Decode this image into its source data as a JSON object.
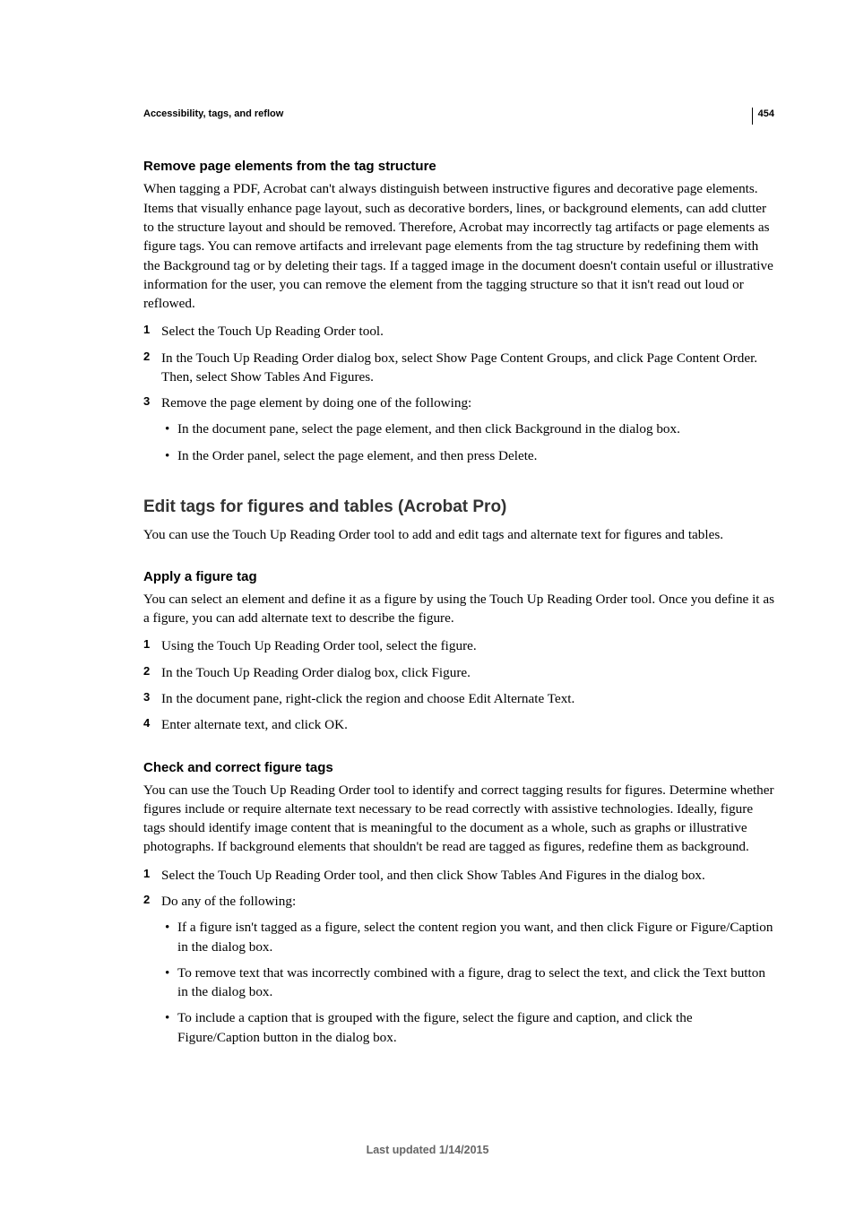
{
  "pageNumber": "454",
  "sectionHeader": "Accessibility, tags, and reflow",
  "s1": {
    "title": "Remove page elements from the tag structure",
    "intro": "When tagging a PDF, Acrobat can't always distinguish between instructive figures and decorative page elements. Items that visually enhance page layout, such as decorative borders, lines, or background elements, can add clutter to the structure layout and should be removed. Therefore, Acrobat may incorrectly tag artifacts or page elements as figure tags. You can remove artifacts and irrelevant page elements from the tag structure by redefining them with the Background tag or by deleting their tags. If a tagged image in the document doesn't contain useful or illustrative information for the user, you can remove the element from the tagging structure so that it isn't read out loud or reflowed.",
    "steps": [
      "Select the Touch Up Reading Order tool.",
      "In the Touch Up Reading Order dialog box, select Show Page Content Groups, and click Page Content Order. Then, select Show Tables And Figures.",
      "Remove the page element by doing one of the following:"
    ],
    "sub": [
      "In the document pane, select the page element, and then click Background in the dialog box.",
      "In the Order panel, select the page element, and then press Delete."
    ]
  },
  "h2": {
    "title": "Edit tags for figures and tables (Acrobat Pro)",
    "intro": "You can use the Touch Up Reading Order tool to add and edit tags and alternate text for figures and tables."
  },
  "s2": {
    "title": "Apply a figure tag",
    "intro": "You can select an element and define it as a figure by using the Touch Up Reading Order tool. Once you define it as a figure, you can add alternate text to describe the figure.",
    "steps": [
      "Using the Touch Up Reading Order tool, select the figure.",
      "In the Touch Up Reading Order dialog box, click Figure.",
      "In the document pane, right-click the region and choose Edit Alternate Text.",
      "Enter alternate text, and click OK."
    ]
  },
  "s3": {
    "title": "Check and correct figure tags",
    "intro": "You can use the Touch Up Reading Order tool to identify and correct tagging results for figures. Determine whether figures include or require alternate text necessary to be read correctly with assistive technologies. Ideally, figure tags should identify image content that is meaningful to the document as a whole, such as graphs or illustrative photographs. If background elements that shouldn't be read are tagged as figures, redefine them as background.",
    "steps": [
      "Select the Touch Up Reading Order tool, and then click Show Tables And Figures in the dialog box.",
      "Do any of the following:"
    ],
    "sub": [
      "If a figure isn't tagged as a figure, select the content region you want, and then click Figure or Figure/Caption in the dialog box.",
      "To remove text that was incorrectly combined with a figure, drag to select the text, and click the Text button in the dialog box.",
      "To include a caption that is grouped with the figure, select the figure and caption, and click the Figure/Caption button in the dialog box."
    ]
  },
  "footer": "Last updated 1/14/2015"
}
